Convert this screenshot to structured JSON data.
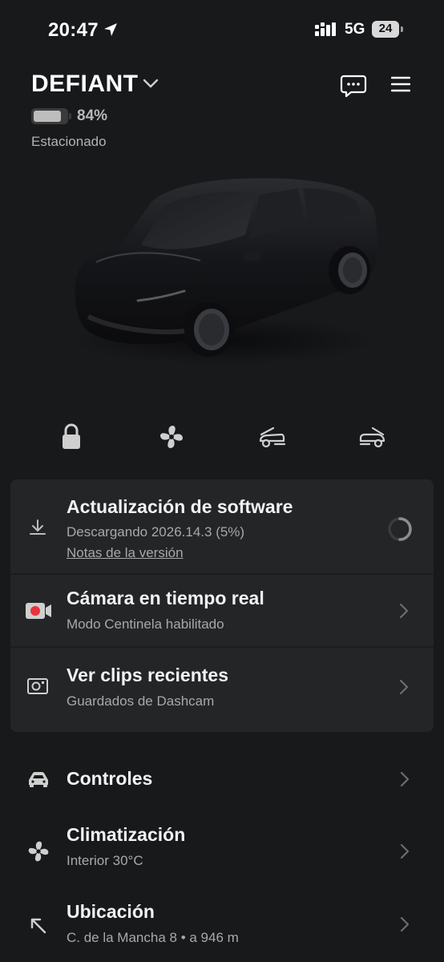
{
  "status_bar": {
    "time": "20:47",
    "network": "5G",
    "battery": "24"
  },
  "header": {
    "vehicle_name": "DEFIANT",
    "battery_percent": "84%",
    "battery_level": 0.84,
    "status": "Estacionado"
  },
  "quick_actions": [
    "lock-icon",
    "fan-icon",
    "frunk-icon",
    "trunk-icon"
  ],
  "card": {
    "software": {
      "title": "Actualización de software",
      "subtitle": "Descargando 2026.14.3 (5%)",
      "link": "Notas de la versión"
    },
    "camera": {
      "title": "Cámara en tiempo real",
      "subtitle": "Modo Centinela habilitado"
    },
    "clips": {
      "title": "Ver clips recientes",
      "subtitle": "Guardados de Dashcam"
    }
  },
  "list": {
    "controls": {
      "title": "Controles"
    },
    "climate": {
      "title": "Climatización",
      "subtitle": "Interior 30°C"
    },
    "location": {
      "title": "Ubicación",
      "subtitle": "C. de la Mancha 8 • a 946 m"
    }
  },
  "colors": {
    "background": "#18191b",
    "card": "#242527",
    "record_red": "#e8323c"
  }
}
